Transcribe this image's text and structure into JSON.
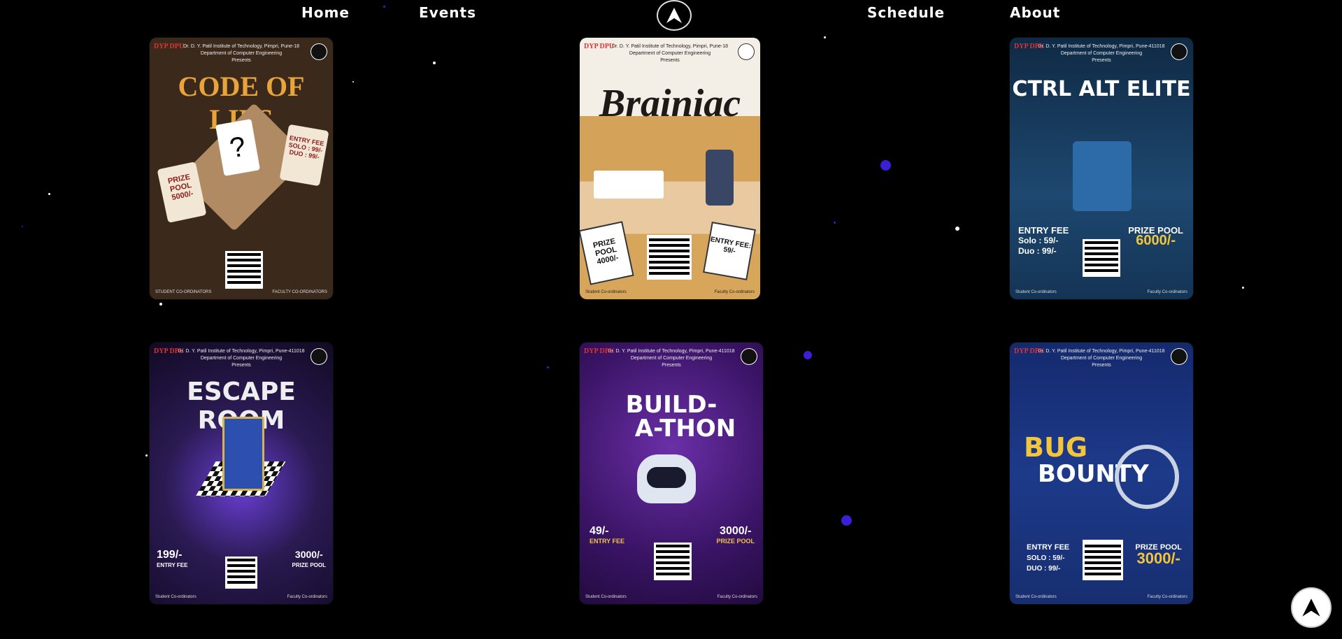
{
  "nav": {
    "items": [
      "Home",
      "Events",
      "Schedule",
      "About"
    ]
  },
  "posters": [
    {
      "title": "CODE OF LIES",
      "institute": "Dr. D. Y. Patil Institute of Technology, Pimpri, Pune-18",
      "department": "Department of Computer Engineering",
      "presents": "Presents",
      "entry_fee": "ENTRY FEE",
      "fee_solo": "SOLO : 99/-",
      "fee_duo": "DUO : 99/-",
      "prize": "PRIZE POOL",
      "prize_amount": "5000/-",
      "student_coord": "STUDENT CO-ORDINATORS",
      "faculty_coord": "FACULTY CO-ORDINATORS"
    },
    {
      "title": "Brainiac",
      "institute": "Dr. D. Y. Patil Institute of Technology, Pimpri, Pune-18",
      "department": "Department of Computer Engineering",
      "presents": "Presents",
      "prize": "PRIZE POOL",
      "prize_amount": "4000/-",
      "entry_fee": "ENTRY FEE: 59/-",
      "student_coord": "Student Co-ordinators",
      "faculty_coord": "Faculty Co-ordinators"
    },
    {
      "title": "CTRL ALT ELITE",
      "institute": "Dr. D. Y. Patil Institute of Technology, Pimpri, Pune-411018",
      "department": "Department of Computer Engineering",
      "presents": "Presents",
      "entry_fee": "ENTRY FEE",
      "fee_solo": "Solo : 59/-",
      "fee_duo": "Duo : 99/-",
      "prize": "PRIZE POOL",
      "prize_amount": "6000/-",
      "student_coord": "Student Co-ordinators",
      "faculty_coord": "Faculty Co-ordinators"
    },
    {
      "title": "ESCAPE ROOM",
      "institute": "Dr. D. Y. Patil Institute of Technology, Pimpri, Pune-411018",
      "department": "Department of Computer Engineering",
      "presents": "Presents",
      "fee_amount": "199/-",
      "entry_fee": "ENTRY FEE",
      "prize_amount": "3000/-",
      "prize": "PRIZE POOL",
      "student_coord": "Student Co-ordinators",
      "faculty_coord": "Faculty Co-ordinators"
    },
    {
      "title_line1": "BUILD-",
      "title_line2": "A-THON",
      "institute": "Dr. D. Y. Patil Institute of Technology, Pimpri, Pune-411018",
      "department": "Department of Computer Engineering",
      "presents": "Presents",
      "fee_amount": "49/-",
      "entry_fee": "ENTRY FEE",
      "prize_amount": "3000/-",
      "prize": "PRIZE POOL",
      "student_coord": "Student Co-ordinators",
      "faculty_coord": "Faculty Co-ordinators"
    },
    {
      "title_line1": "BUG",
      "title_line2": "BOUNTY",
      "institute": "Dr. D. Y. Patil Institute of Technology, Pimpri, Pune-411018",
      "department": "Department of Computer Engineering",
      "presents": "Presents",
      "entry_fee": "ENTRY FEE",
      "fee_solo": "SOLO : 59/-",
      "fee_duo": "DUO : 99/-",
      "prize": "PRIZE POOL",
      "prize_amount": "3000/-",
      "student_coord": "Student Co-ordinators",
      "faculty_coord": "Faculty Co-ordinators"
    }
  ],
  "colors": {
    "background": "#000000",
    "accent_blue": "#3b1fd6"
  }
}
